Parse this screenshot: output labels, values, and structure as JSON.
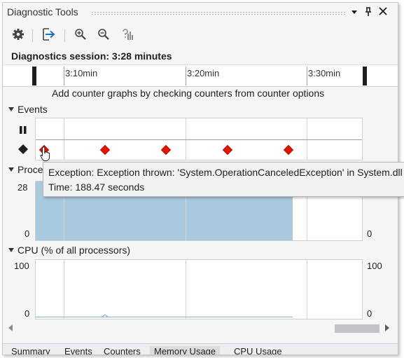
{
  "window": {
    "title": "Diagnostic Tools"
  },
  "session": {
    "text": "Diagnostics session: 3:28 minutes"
  },
  "ruler": {
    "labels": [
      "3:10min",
      "3:20min",
      "3:30min"
    ]
  },
  "hint": "Add counter graphs by checking counters from counter options",
  "sections": {
    "events": "Events",
    "process": "Process Memory (MB)",
    "cpu": "CPU (% of all processors)"
  },
  "process_axis": {
    "left_top": "28",
    "left_bottom": "0",
    "right_bottom": "0"
  },
  "cpu_axis": {
    "left_top": "100",
    "left_bottom": "0",
    "right_top": "100",
    "right_bottom": "0"
  },
  "tooltip": {
    "line1": "Exception: Exception thrown: 'System.OperationCanceledException' in System.dll",
    "line2": "Time: 188.47 seconds"
  },
  "tabs": [
    "Summary",
    "Events",
    "Counters",
    "Memory Usage",
    "CPU Usage"
  ],
  "colors": {
    "event_marker": "#e51400",
    "memory_fill": "#a9c9de",
    "accent": "#1e6fc4"
  },
  "icons": {
    "settings": "gear-icon",
    "select_tools": "export-icon",
    "zoom_in": "zoom-in-icon",
    "zoom_out": "zoom-out-icon",
    "reset_zoom": "reset-zoom-icon",
    "pause": "pause-icon",
    "event": "diamond-icon"
  }
}
